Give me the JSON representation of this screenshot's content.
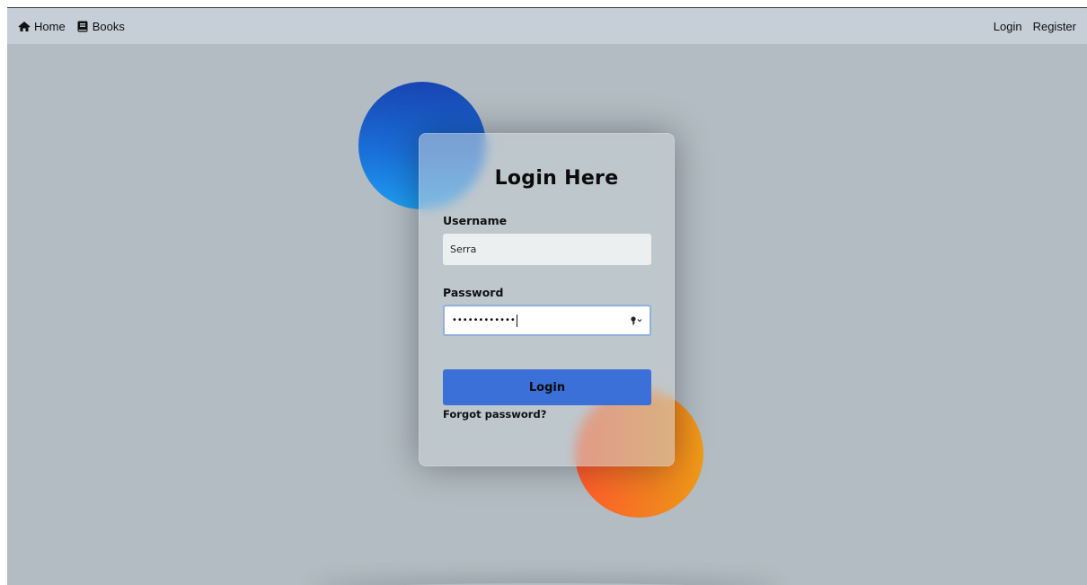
{
  "navbar": {
    "home_label": "Home",
    "books_label": "Books",
    "login_label": "Login",
    "register_label": "Register"
  },
  "form": {
    "title": "Login Here",
    "username_label": "Username",
    "username_value": "Serra",
    "password_label": "Password",
    "password_masked": "••••••••••••",
    "login_button": "Login",
    "forgot_link": "Forgot password?"
  },
  "icons": {
    "home": "home-icon",
    "books": "book-icon",
    "key": "key-icon"
  },
  "colors": {
    "navbar_bg": "#c6ced8",
    "page_bg": "#b2bcc2",
    "login_button": "#3a70d8",
    "circle_blue": "#1a6fd8",
    "circle_orange": "#f2801f",
    "input_focus_border": "#8fb0dc"
  }
}
